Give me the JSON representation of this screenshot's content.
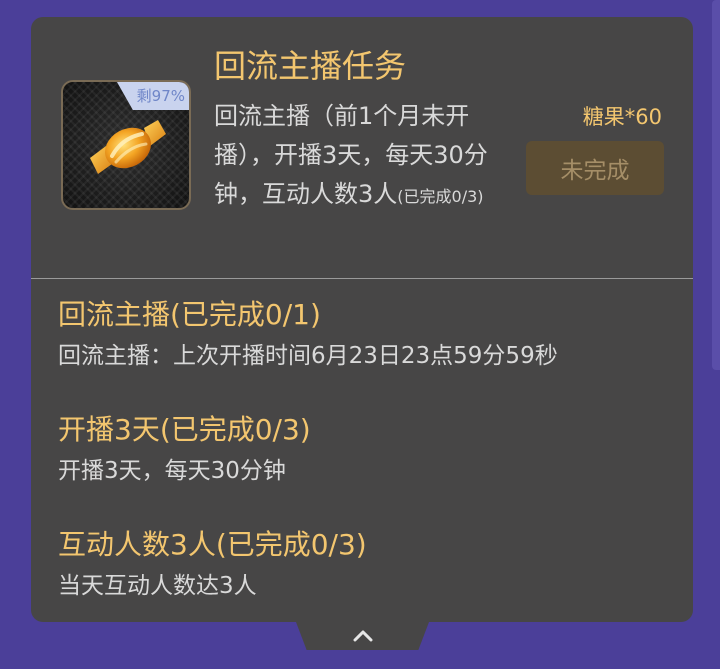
{
  "card": {
    "title": "回流主播任务",
    "description": "回流主播（前1个月未开播），开播3天，每天30分钟，互动人数3人",
    "description_progress": "(已完成0/3)",
    "reward": "糖果*60",
    "status_label": "未完成",
    "thumbnail": {
      "icon": "candy-icon",
      "badge": "剩97%"
    }
  },
  "tasks": [
    {
      "title": "回流主播(已完成0/1)",
      "desc": "回流主播：上次开播时间6月23日23点59分59秒"
    },
    {
      "title": "开播3天(已完成0/3)",
      "desc": "开播3天，每天30分钟"
    },
    {
      "title": "互动人数3人(已完成0/3)",
      "desc": "当天互动人数达3人"
    }
  ],
  "collapse": {
    "icon": "chevron-up-icon"
  },
  "colors": {
    "background": "#4b3f99",
    "card": "#474646",
    "accent": "#f3c66f",
    "text": "#d9d9d9",
    "status_button": "#5c4d33"
  }
}
